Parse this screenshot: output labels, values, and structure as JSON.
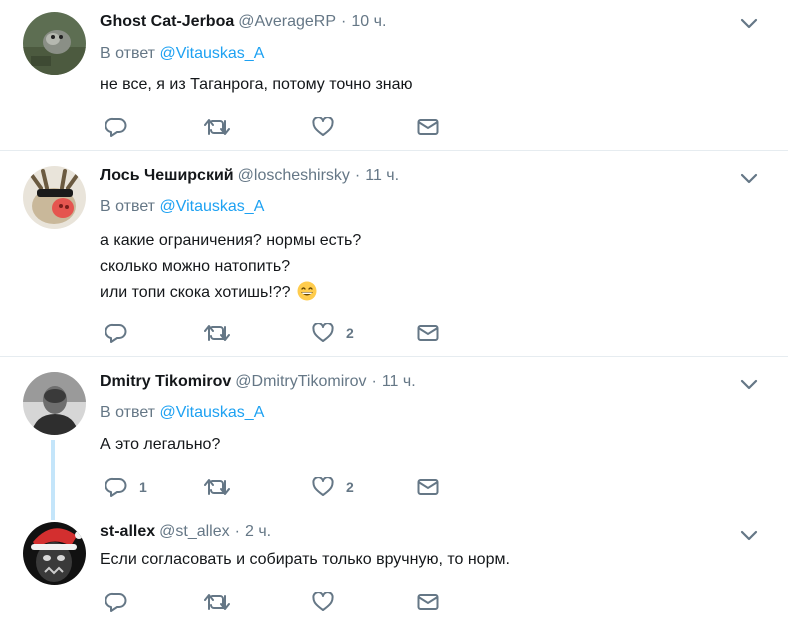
{
  "tweets": [
    {
      "name": "Ghost Cat-Jerboa",
      "handle": "@AverageRP",
      "dot": "·",
      "time": "10 ч.",
      "reply_prefix": "В ответ",
      "reply_mention": "@Vitauskas_A",
      "lines": [
        "не все, я из Таганрога, потому точно знаю"
      ],
      "like_count": "",
      "reply_count": ""
    },
    {
      "name": "Лось Чеширский",
      "handle": "@loscheshirsky",
      "dot": "·",
      "time": "11 ч.",
      "reply_prefix": "В ответ",
      "reply_mention": "@Vitauskas_A",
      "lines": [
        "а какие ограничения? нормы есть?",
        "сколько можно натопить?",
        "или топи скока хотишь!??"
      ],
      "emoji": "grinning-face-emoji",
      "like_count": "2",
      "reply_count": ""
    },
    {
      "name": "Dmitry Tikomirov",
      "handle": "@DmitryTikomirov",
      "dot": "·",
      "time": "11 ч.",
      "reply_prefix": "В ответ",
      "reply_mention": "@Vitauskas_A",
      "lines": [
        "А это легально?"
      ],
      "like_count": "2",
      "reply_count": "1"
    },
    {
      "name": "st-allex",
      "handle": "@st_allex",
      "dot": "·",
      "time": "2 ч.",
      "lines": [
        "Если согласовать и собирать только вручную, то норм."
      ],
      "like_count": "",
      "reply_count": ""
    }
  ],
  "icons": {
    "reply": "reply-icon",
    "retweet": "retweet-icon",
    "like": "heart-icon",
    "dm": "envelope-icon",
    "more": "chevron-down-icon"
  },
  "colors": {
    "icon": "#657786",
    "link": "#1da1f2",
    "thread_line": "#c4e5fa",
    "divider": "#e6ecf0"
  }
}
